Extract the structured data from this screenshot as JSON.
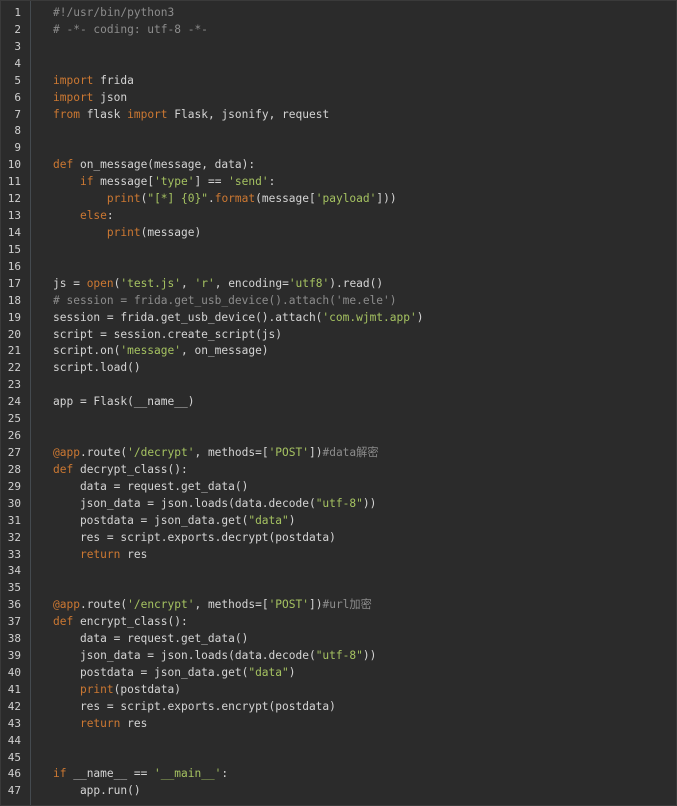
{
  "editor": {
    "language": "python",
    "colors": {
      "background": "#2b2b2b",
      "keyword": "#cc7832",
      "string": "#a5c261",
      "comment": "#8c8c8c",
      "text": "#d4d4d4",
      "line_number": "#d0d0d0"
    },
    "lines": [
      {
        "n": "1",
        "tokens": [
          [
            "cmt",
            "#!/usr/bin/python3"
          ]
        ]
      },
      {
        "n": "2",
        "tokens": [
          [
            "cmt",
            "# -*- coding: utf-8 -*-"
          ]
        ]
      },
      {
        "n": "3",
        "tokens": []
      },
      {
        "n": "4",
        "tokens": []
      },
      {
        "n": "5",
        "tokens": [
          [
            "kw",
            "import"
          ],
          [
            "pl",
            " frida"
          ]
        ]
      },
      {
        "n": "6",
        "tokens": [
          [
            "kw",
            "import"
          ],
          [
            "pl",
            " json"
          ]
        ]
      },
      {
        "n": "7",
        "tokens": [
          [
            "kw",
            "from"
          ],
          [
            "pl",
            " flask "
          ],
          [
            "kw",
            "import"
          ],
          [
            "pl",
            " Flask, jsonify, request"
          ]
        ]
      },
      {
        "n": "8",
        "tokens": []
      },
      {
        "n": "9",
        "tokens": []
      },
      {
        "n": "10",
        "tokens": [
          [
            "kw",
            "def"
          ],
          [
            "pl",
            " on_message(message, data):"
          ]
        ]
      },
      {
        "n": "11",
        "tokens": [
          [
            "pl",
            "    "
          ],
          [
            "kw",
            "if"
          ],
          [
            "pl",
            " message["
          ],
          [
            "str",
            "'type'"
          ],
          [
            "pl",
            "] == "
          ],
          [
            "str",
            "'send'"
          ],
          [
            "pl",
            ":"
          ]
        ]
      },
      {
        "n": "12",
        "tokens": [
          [
            "pl",
            "        "
          ],
          [
            "bi",
            "print"
          ],
          [
            "pl",
            "("
          ],
          [
            "str",
            "\"[*] {0}\""
          ],
          [
            "pl",
            "."
          ],
          [
            "bi",
            "format"
          ],
          [
            "pl",
            "(message["
          ],
          [
            "str",
            "'payload'"
          ],
          [
            "pl",
            "]))"
          ]
        ]
      },
      {
        "n": "13",
        "tokens": [
          [
            "pl",
            "    "
          ],
          [
            "kw",
            "else"
          ],
          [
            "pl",
            ":"
          ]
        ]
      },
      {
        "n": "14",
        "tokens": [
          [
            "pl",
            "        "
          ],
          [
            "bi",
            "print"
          ],
          [
            "pl",
            "(message)"
          ]
        ]
      },
      {
        "n": "15",
        "tokens": []
      },
      {
        "n": "16",
        "tokens": []
      },
      {
        "n": "17",
        "tokens": [
          [
            "pl",
            "js = "
          ],
          [
            "bi",
            "open"
          ],
          [
            "pl",
            "("
          ],
          [
            "str",
            "'test.js'"
          ],
          [
            "pl",
            ", "
          ],
          [
            "str",
            "'r'"
          ],
          [
            "pl",
            ", encoding="
          ],
          [
            "str",
            "'utf8'"
          ],
          [
            "pl",
            ").read()"
          ]
        ]
      },
      {
        "n": "18",
        "tokens": [
          [
            "cmt",
            "# session = frida.get_usb_device().attach('me.ele')"
          ]
        ]
      },
      {
        "n": "19",
        "tokens": [
          [
            "pl",
            "session = frida.get_usb_device().attach("
          ],
          [
            "str",
            "'com.wjmt.app'"
          ],
          [
            "pl",
            ")"
          ]
        ]
      },
      {
        "n": "20",
        "tokens": [
          [
            "pl",
            "script = session.create_script(js)"
          ]
        ]
      },
      {
        "n": "21",
        "tokens": [
          [
            "pl",
            "script.on("
          ],
          [
            "str",
            "'message'"
          ],
          [
            "pl",
            ", on_message)"
          ]
        ]
      },
      {
        "n": "22",
        "tokens": [
          [
            "pl",
            "script.load()"
          ]
        ]
      },
      {
        "n": "23",
        "tokens": []
      },
      {
        "n": "24",
        "tokens": [
          [
            "pl",
            "app = Flask(__name__)"
          ]
        ]
      },
      {
        "n": "25",
        "tokens": []
      },
      {
        "n": "26",
        "tokens": []
      },
      {
        "n": "27",
        "tokens": [
          [
            "dec",
            "@app"
          ],
          [
            "pl",
            ".route("
          ],
          [
            "str",
            "'/decrypt'"
          ],
          [
            "pl",
            ", methods=["
          ],
          [
            "str",
            "'POST'"
          ],
          [
            "pl",
            "])"
          ],
          [
            "cmt",
            "#data解密"
          ]
        ]
      },
      {
        "n": "28",
        "tokens": [
          [
            "kw",
            "def"
          ],
          [
            "pl",
            " decrypt_class():"
          ]
        ]
      },
      {
        "n": "29",
        "tokens": [
          [
            "pl",
            "    data = request.get_data()"
          ]
        ]
      },
      {
        "n": "30",
        "tokens": [
          [
            "pl",
            "    json_data = json.loads(data.decode("
          ],
          [
            "str",
            "\"utf-8\""
          ],
          [
            "pl",
            "))"
          ]
        ]
      },
      {
        "n": "31",
        "tokens": [
          [
            "pl",
            "    postdata = json_data.get("
          ],
          [
            "str",
            "\"data\""
          ],
          [
            "pl",
            ")"
          ]
        ]
      },
      {
        "n": "32",
        "tokens": [
          [
            "pl",
            "    res = script.exports.decrypt(postdata)"
          ]
        ]
      },
      {
        "n": "33",
        "tokens": [
          [
            "pl",
            "    "
          ],
          [
            "kw",
            "return"
          ],
          [
            "pl",
            " res"
          ]
        ]
      },
      {
        "n": "34",
        "tokens": []
      },
      {
        "n": "35",
        "tokens": []
      },
      {
        "n": "36",
        "tokens": [
          [
            "dec",
            "@app"
          ],
          [
            "pl",
            ".route("
          ],
          [
            "str",
            "'/encrypt'"
          ],
          [
            "pl",
            ", methods=["
          ],
          [
            "str",
            "'POST'"
          ],
          [
            "pl",
            "])"
          ],
          [
            "cmt",
            "#url加密"
          ]
        ]
      },
      {
        "n": "37",
        "tokens": [
          [
            "kw",
            "def"
          ],
          [
            "pl",
            " encrypt_class():"
          ]
        ]
      },
      {
        "n": "38",
        "tokens": [
          [
            "pl",
            "    data = request.get_data()"
          ]
        ]
      },
      {
        "n": "39",
        "tokens": [
          [
            "pl",
            "    json_data = json.loads(data.decode("
          ],
          [
            "str",
            "\"utf-8\""
          ],
          [
            "pl",
            "))"
          ]
        ]
      },
      {
        "n": "40",
        "tokens": [
          [
            "pl",
            "    postdata = json_data.get("
          ],
          [
            "str",
            "\"data\""
          ],
          [
            "pl",
            ")"
          ]
        ]
      },
      {
        "n": "41",
        "tokens": [
          [
            "pl",
            "    "
          ],
          [
            "bi",
            "print"
          ],
          [
            "pl",
            "(postdata)"
          ]
        ]
      },
      {
        "n": "42",
        "tokens": [
          [
            "pl",
            "    res = script.exports.encrypt(postdata)"
          ]
        ]
      },
      {
        "n": "43",
        "tokens": [
          [
            "pl",
            "    "
          ],
          [
            "kw",
            "return"
          ],
          [
            "pl",
            " res"
          ]
        ]
      },
      {
        "n": "44",
        "tokens": []
      },
      {
        "n": "45",
        "tokens": []
      },
      {
        "n": "46",
        "tokens": [
          [
            "kw",
            "if"
          ],
          [
            "pl",
            " __name__ == "
          ],
          [
            "str",
            "'__main__'"
          ],
          [
            "pl",
            ":"
          ]
        ]
      },
      {
        "n": "47",
        "tokens": [
          [
            "pl",
            "    app.run()"
          ]
        ]
      }
    ]
  }
}
